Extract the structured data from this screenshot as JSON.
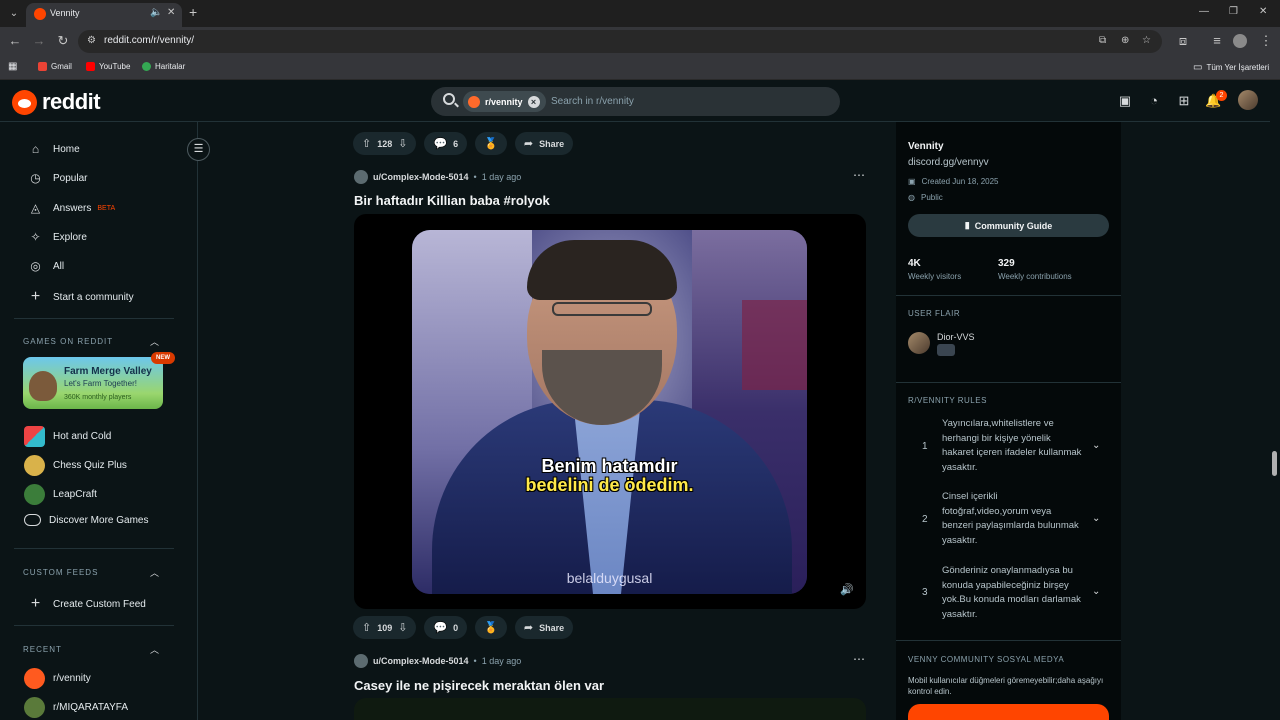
{
  "browser": {
    "tab_title": "Vennity",
    "url": "reddit.com/r/vennity/",
    "bookmarks": [
      "Gmail",
      "YouTube",
      "Haritalar"
    ],
    "all_bookmarks": "Tüm Yer İşaretleri"
  },
  "header": {
    "logo": "reddit",
    "search_chip": "r/vennity",
    "search_placeholder": "Search in r/vennity",
    "notification_count": "2"
  },
  "sidebar": {
    "nav": [
      {
        "label": "Home",
        "icon": "home-icon"
      },
      {
        "label": "Popular",
        "icon": "popular-icon"
      },
      {
        "label": "Answers",
        "badge": "BETA",
        "icon": "answers-icon"
      },
      {
        "label": "Explore",
        "icon": "explore-icon"
      },
      {
        "label": "All",
        "icon": "all-icon"
      },
      {
        "label": "Start a community",
        "icon": "plus-icon"
      }
    ],
    "games_header": "GAMES ON REDDIT",
    "featured_game": {
      "title": "Farm Merge Valley",
      "subtitle": "Let's Farm Together!",
      "players": "360K monthly players",
      "badge": "NEW"
    },
    "games": [
      "Hot and Cold",
      "Chess Quiz Plus",
      "LeapCraft",
      "Discover More Games"
    ],
    "custom_feeds_header": "CUSTOM FEEDS",
    "create_custom_feed": "Create Custom Feed",
    "recent_header": "RECENT",
    "recent": [
      "r/vennity",
      "r/MIQARATAYFA"
    ]
  },
  "feed": {
    "top_actions": {
      "votes": "128",
      "comments": "6",
      "share": "Share"
    },
    "post1": {
      "user": "u/Complex-Mode-5014",
      "time": "1 day ago",
      "title": "Bir haftadır Killian baba #rolyok",
      "subtitle_line1": "Benim hatamdır",
      "subtitle_line2": "bedelini de ödedim.",
      "watermark": "belalduygusal",
      "votes": "109",
      "comments": "0",
      "share": "Share"
    },
    "post2": {
      "user": "u/Complex-Mode-5014",
      "time": "1 day ago",
      "title": "Casey ile ne pişirecek meraktan ölen var"
    }
  },
  "community": {
    "name": "Vennity",
    "description": "discord.gg/vennyv",
    "created": "Created Jun 18, 2025",
    "visibility": "Public",
    "guide_button": "Community Guide",
    "weekly_visitors": "4K",
    "weekly_visitors_label": "Weekly visitors",
    "weekly_contributions": "329",
    "weekly_contributions_label": "Weekly contributions",
    "user_flair_header": "USER FLAIR",
    "flair_name": "Dior-VVS",
    "rules_header": "R/VENNITY RULES",
    "rules": [
      {
        "num": "1",
        "text": "Yayıncılara,whitelistlere ve herhangi bir kişiye yönelik hakaret içeren ifadeler kullanmak yasaktır."
      },
      {
        "num": "2",
        "text": "Cinsel içerikli fotoğraf,video,yorum veya benzeri paylaşımlarda bulunmak yasaktır."
      },
      {
        "num": "3",
        "text": "Gönderiniz onaylanmadıysa bu konuda yapabileceğiniz birşey yok.Bu konuda modları darlamak yasaktır."
      }
    ],
    "social_header": "VENNY COMMUNITY SOSYAL MEDYA",
    "social_desc": "Mobil kullanıcılar düğmeleri göremeyebilir;daha aşağıyı kontrol edin."
  },
  "colors": {
    "accent": "#ff4500",
    "bg": "#0b1416",
    "panel": "#04090a"
  }
}
